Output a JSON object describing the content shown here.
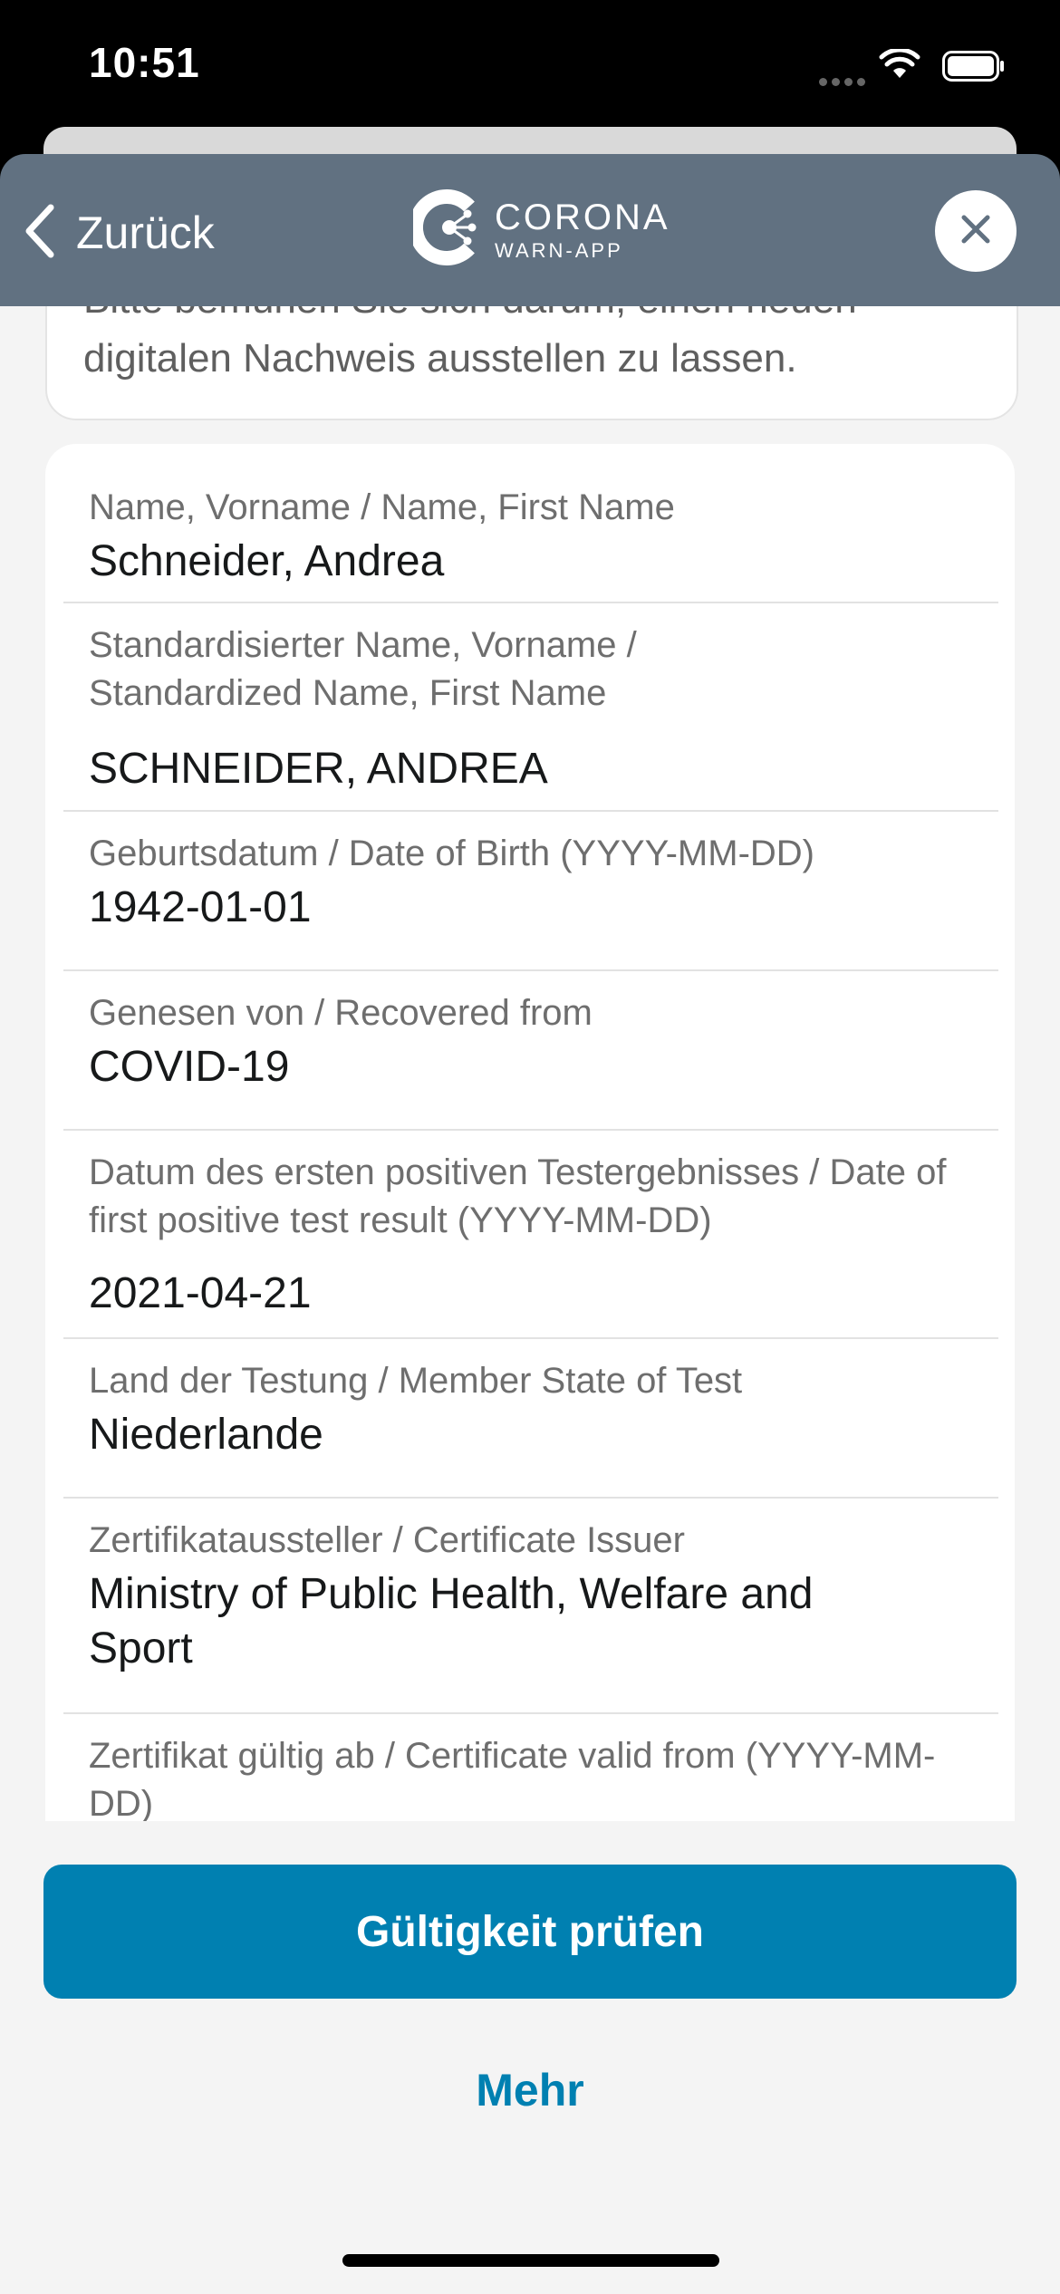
{
  "status_bar": {
    "time": "10:51"
  },
  "navbar": {
    "back_label": "Zurück",
    "logo_line1": "CORONA",
    "logo_line2": "WARN-APP"
  },
  "info_card": {
    "partial_text": "Bitte bemühen Sie sich darum, einen neuen",
    "text": "digitalen Nachweis ausstellen zu lassen."
  },
  "details": [
    {
      "label": "Name, Vorname / Name, First Name",
      "value": "Schneider, Andrea"
    },
    {
      "label": "Standardisierter Name, Vorname / Standardized Name, First Name",
      "value": "SCHNEIDER, ANDREA"
    },
    {
      "label": "Geburtsdatum / Date of Birth (YYYY-MM-DD)",
      "value": "1942-01-01"
    },
    {
      "label": "Genesen von / Recovered from",
      "value": "COVID-19"
    },
    {
      "label": "Datum des ersten positiven Testergebnisses / Date of first positive test result (YYYY-MM-DD)",
      "value": "2021-04-21"
    },
    {
      "label": "Land der Testung / Member State of Test",
      "value": "Niederlande"
    },
    {
      "label": "Zertifikataussteller / Certificate Issuer",
      "value": "Ministry of Public Health, Welfare and Sport"
    },
    {
      "label": "Zertifikat gültig ab / Certificate valid from (YYYY-MM-DD)",
      "value": ""
    }
  ],
  "actions": {
    "primary_label": "Gültigkeit prüfen",
    "more_label": "Mehr"
  },
  "colors": {
    "navbar": "#617181",
    "accent": "#0080b1",
    "background": "#f4f4f4"
  }
}
